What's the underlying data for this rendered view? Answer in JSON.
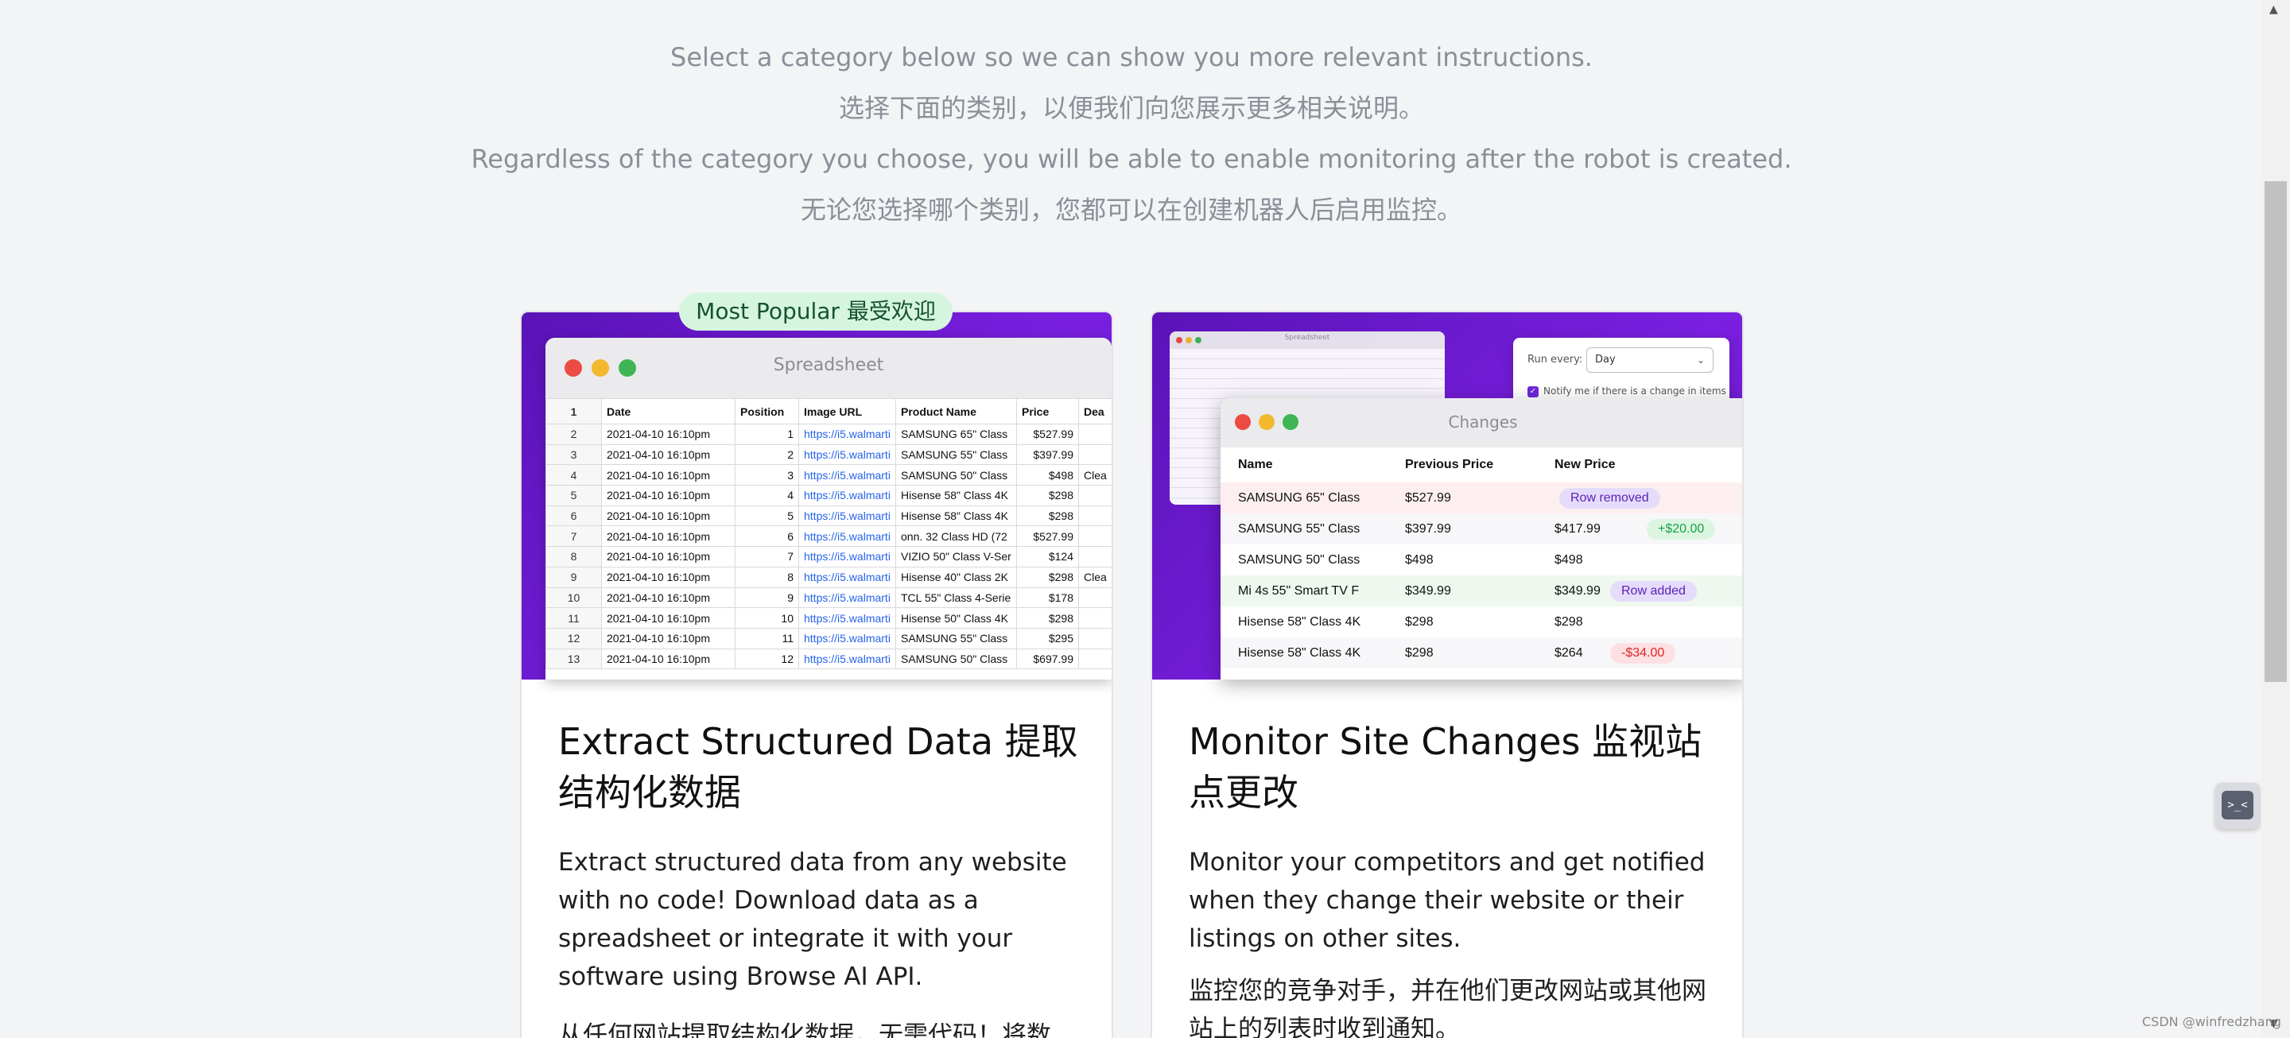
{
  "intro": {
    "line1": "Select a category below so we can show you more relevant instructions.",
    "line2": "选择下面的类别，以便我们向您展示更多相关说明。",
    "line3": "Regardless of the category you choose, you will be able to enable monitoring after the robot is created.",
    "line4": "无论您选择哪个类别，您都可以在创建机器人后启用监控。"
  },
  "extract_card": {
    "badge": "Most Popular 最受欢迎",
    "window_title": "Spreadsheet",
    "header": [
      "1",
      "Date",
      "Position",
      "Image URL",
      "Product Name",
      "Price",
      "Dea"
    ],
    "rows": [
      [
        "2",
        "2021-04-10 16:10pm",
        "1",
        "https://i5.walmarti",
        "SAMSUNG 65\" Class",
        "$527.99",
        ""
      ],
      [
        "3",
        "2021-04-10 16:10pm",
        "2",
        "https://i5.walmarti",
        "SAMSUNG 55\" Class",
        "$397.99",
        ""
      ],
      [
        "4",
        "2021-04-10 16:10pm",
        "3",
        "https://i5.walmarti",
        "SAMSUNG 50\" Class",
        "$498",
        "Clea"
      ],
      [
        "5",
        "2021-04-10 16:10pm",
        "4",
        "https://i5.walmarti",
        "Hisense 58\" Class 4K",
        "$298",
        ""
      ],
      [
        "6",
        "2021-04-10 16:10pm",
        "5",
        "https://i5.walmarti",
        "Hisense 58\" Class 4K",
        "$298",
        ""
      ],
      [
        "7",
        "2021-04-10 16:10pm",
        "6",
        "https://i5.walmarti",
        "onn. 32 Class HD (72",
        "$527.99",
        ""
      ],
      [
        "8",
        "2021-04-10 16:10pm",
        "7",
        "https://i5.walmarti",
        "VIZIO 50\" Class V-Ser",
        "$124",
        ""
      ],
      [
        "9",
        "2021-04-10 16:10pm",
        "8",
        "https://i5.walmarti",
        "Hisense 40\" Class 2K",
        "$298",
        "Clea"
      ],
      [
        "10",
        "2021-04-10 16:10pm",
        "9",
        "https://i5.walmarti",
        "TCL 55\" Class 4-Serie",
        "$178",
        ""
      ],
      [
        "11",
        "2021-04-10 16:10pm",
        "10",
        "https://i5.walmarti",
        "Hisense 50\" Class 4K",
        "$298",
        ""
      ],
      [
        "12",
        "2021-04-10 16:10pm",
        "11",
        "https://i5.walmarti",
        "SAMSUNG 55\" Class",
        "$295",
        ""
      ],
      [
        "13",
        "2021-04-10 16:10pm",
        "12",
        "https://i5.walmarti",
        "SAMSUNG 50\" Class",
        "$697.99",
        ""
      ]
    ],
    "title": "Extract Structured Data 提取结构化数据",
    "description": "Extract structured data from any website with no code! Download data as a spreadsheet or integrate it with your software using Browse AI API.",
    "description_zh": "从任何网站提取结构化数据，无需代码！将数"
  },
  "monitor_card": {
    "mini_title": "Spreadsheet",
    "run_every_label": "Run every:",
    "run_every_value": "Day",
    "notify_label": "Notify me if there is a change in items",
    "window_title": "Changes",
    "columns": [
      "Name",
      "Previous Price",
      "New Price"
    ],
    "rows": [
      {
        "name": "SAMSUNG 65\" Class",
        "prev": "$527.99",
        "new": "",
        "pill": "Row removed",
        "pill_type": "purple",
        "row_type": "removed"
      },
      {
        "name": "SAMSUNG 55\" Class",
        "prev": "$397.99",
        "new": "$417.99",
        "pill": "+$20.00",
        "pill_type": "green",
        "row_type": "alt"
      },
      {
        "name": "SAMSUNG 50\" Class",
        "prev": "$498",
        "new": "$498",
        "pill": "",
        "pill_type": "",
        "row_type": ""
      },
      {
        "name": "Mi 4s 55\" Smart TV F",
        "prev": "$349.99",
        "new": "$349.99",
        "pill": "Row added",
        "pill_type": "purple",
        "row_type": "added"
      },
      {
        "name": "Hisense 58\" Class 4K",
        "prev": "$298",
        "new": "$298",
        "pill": "",
        "pill_type": "",
        "row_type": ""
      },
      {
        "name": "Hisense 58\" Class 4K",
        "prev": "$298",
        "new": "$264",
        "pill": "-$34.00",
        "pill_type": "red",
        "row_type": "alt"
      }
    ],
    "title": "Monitor Site Changes 监视站点更改",
    "description": "Monitor your competitors and get notified when they change their website or their listings on other sites.",
    "description_zh": "监控您的竞争对手，并在他们更改网站或其他网站上的列表时收到通知。"
  },
  "float_button": {
    "icon": "terminal-icon",
    "glyph": ">_<"
  },
  "watermark": "CSDN @winfredzhang",
  "colors": {
    "accent": "#6d28d9",
    "hero": "#7a1fe0",
    "badge_bg": "#d6f5df"
  }
}
